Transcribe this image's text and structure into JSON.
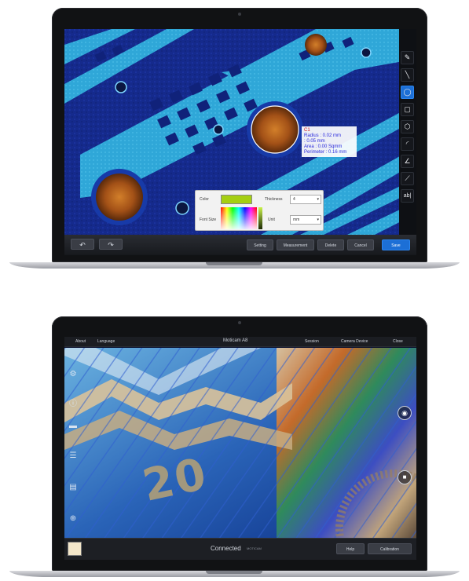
{
  "top_app": {
    "measurement": {
      "id": "C1",
      "radius": "Radius : 0.02 mm",
      "radius2": ": 0.05 mm",
      "area": "Area : 0.00 Sqmm",
      "perimeter": "Perimeter : 0.16 mm"
    },
    "panel": {
      "color_label": "Color",
      "font_size_label": "Font Size",
      "thickness_label": "Thickness",
      "thickness_value": "4",
      "unit_label": "Unit",
      "unit_value": "mm",
      "color_value": "#a5cf12"
    },
    "bottom_buttons": [
      "Setting",
      "Measurement",
      "Delete",
      "Cancel",
      "Save"
    ],
    "tools": [
      "pencil-icon",
      "line-icon",
      "circle-icon",
      "rectangle-icon",
      "polygon-icon",
      "arc-icon",
      "angle-icon",
      "ruler-icon",
      "text-icon"
    ]
  },
  "bottom_app": {
    "top_bar": {
      "left_items": [
        "About",
        "Language"
      ],
      "title": "Moticam A8",
      "right_items": [
        "Session",
        "Camera Device",
        "Close"
      ]
    },
    "overlay_number": "20",
    "status": {
      "connected": "Connected",
      "detail": "MOTICAM"
    },
    "bottom_buttons": [
      "Help",
      "Calibration"
    ]
  }
}
